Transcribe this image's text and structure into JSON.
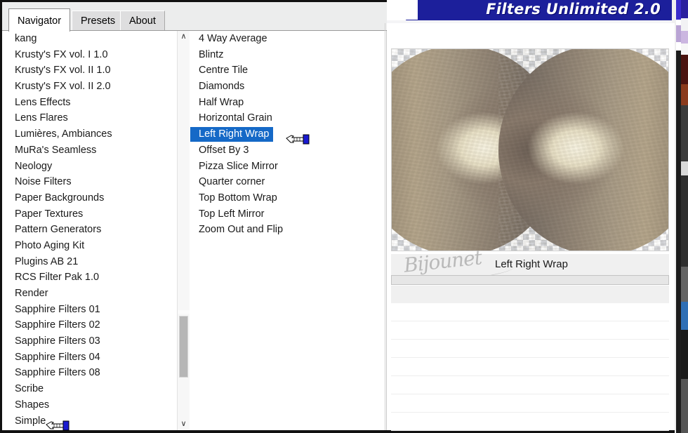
{
  "window": {
    "title": "Filters Unlimited 2.0"
  },
  "tabs": [
    {
      "label": "Navigator",
      "active": true
    },
    {
      "label": "Presets",
      "active": false
    },
    {
      "label": "About",
      "active": false
    }
  ],
  "categories": {
    "items": [
      "kang",
      "Krusty's FX vol. I 1.0",
      "Krusty's FX vol. II 1.0",
      "Krusty's FX vol. II 2.0",
      "Lens Effects",
      "Lens Flares",
      "Lumières, Ambiances",
      "MuRa's Seamless",
      "Neology",
      "Noise Filters",
      "Paper Backgrounds",
      "Paper Textures",
      "Pattern Generators",
      "Photo Aging Kit",
      "Plugins AB 21",
      "RCS Filter Pak 1.0",
      "Render",
      "Sapphire Filters 01",
      "Sapphire Filters 02",
      "Sapphire Filters 03",
      "Sapphire Filters 04",
      "Sapphire Filters 08",
      "Scribe",
      "Shapes",
      "Simple"
    ],
    "pointed_item": "Simple",
    "scrollbar": {
      "up_arrow": "∧",
      "down_arrow": "∨"
    }
  },
  "effects": {
    "items": [
      "4 Way Average",
      "Blintz",
      "Centre Tile",
      "Diamonds",
      "Half Wrap",
      "Horizontal Grain",
      "Left Right Wrap",
      "Offset By 3",
      "Pizza Slice Mirror",
      "Quarter corner",
      "Top Bottom Wrap",
      "Top Left Mirror",
      "Zoom Out and Flip"
    ],
    "selected": "Left Right Wrap",
    "selection_color": "#1569c7"
  },
  "preview": {
    "filter_name": "Left Right Wrap",
    "watermark": "Bijounet"
  }
}
